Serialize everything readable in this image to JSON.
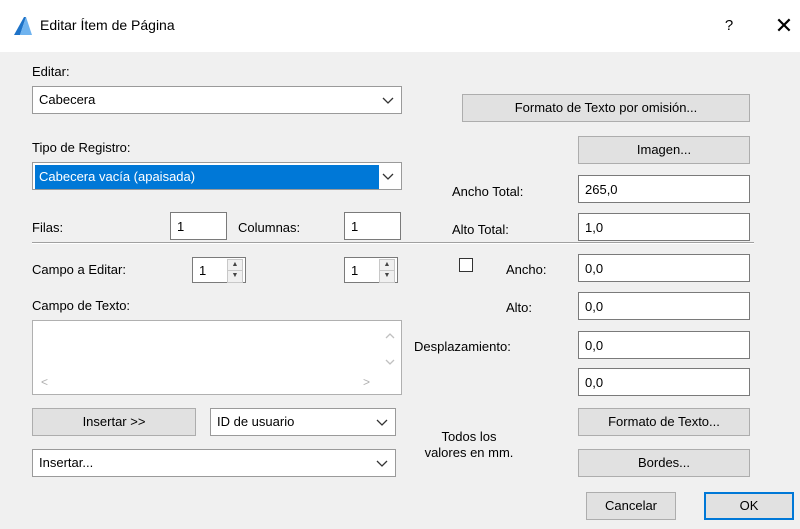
{
  "window": {
    "title": "Editar Ítem de Página",
    "help": "?",
    "close": "✕"
  },
  "editar": {
    "label": "Editar:",
    "value": "Cabecera"
  },
  "tipo_registro": {
    "label": "Tipo de Registro:",
    "value": "Cabecera vacía (apaisada)"
  },
  "filas": {
    "label": "Filas:",
    "value": "1"
  },
  "columnas": {
    "label": "Columnas:",
    "value": "1"
  },
  "campo_editar": {
    "label": "Campo a Editar:",
    "value1": "1",
    "value2": "1"
  },
  "campo_texto": {
    "label": "Campo de Texto:",
    "scroll_left": "<",
    "scroll_right": ">"
  },
  "insertar_button": "Insertar >>",
  "id_usuario": {
    "value": "ID de usuario"
  },
  "insertar_combo": {
    "value": "Insertar..."
  },
  "note": {
    "line1": "Todos los",
    "line2": "valores en mm."
  },
  "formato_omision": "Formato de Texto por omisión...",
  "imagen": "Imagen...",
  "ancho_total": {
    "label": "Ancho Total:",
    "value": "265,0"
  },
  "alto_total": {
    "label": "Alto Total:",
    "value": "1,0"
  },
  "ancho": {
    "label": "Ancho:",
    "value": "0,0"
  },
  "alto": {
    "label": "Alto:",
    "value": "0,0"
  },
  "desplazamiento": {
    "label": "Desplazamiento:",
    "value1": "0,0",
    "value2": "0,0"
  },
  "formato_texto": "Formato de Texto...",
  "bordes": "Bordes...",
  "cancelar": "Cancelar",
  "ok": "OK"
}
